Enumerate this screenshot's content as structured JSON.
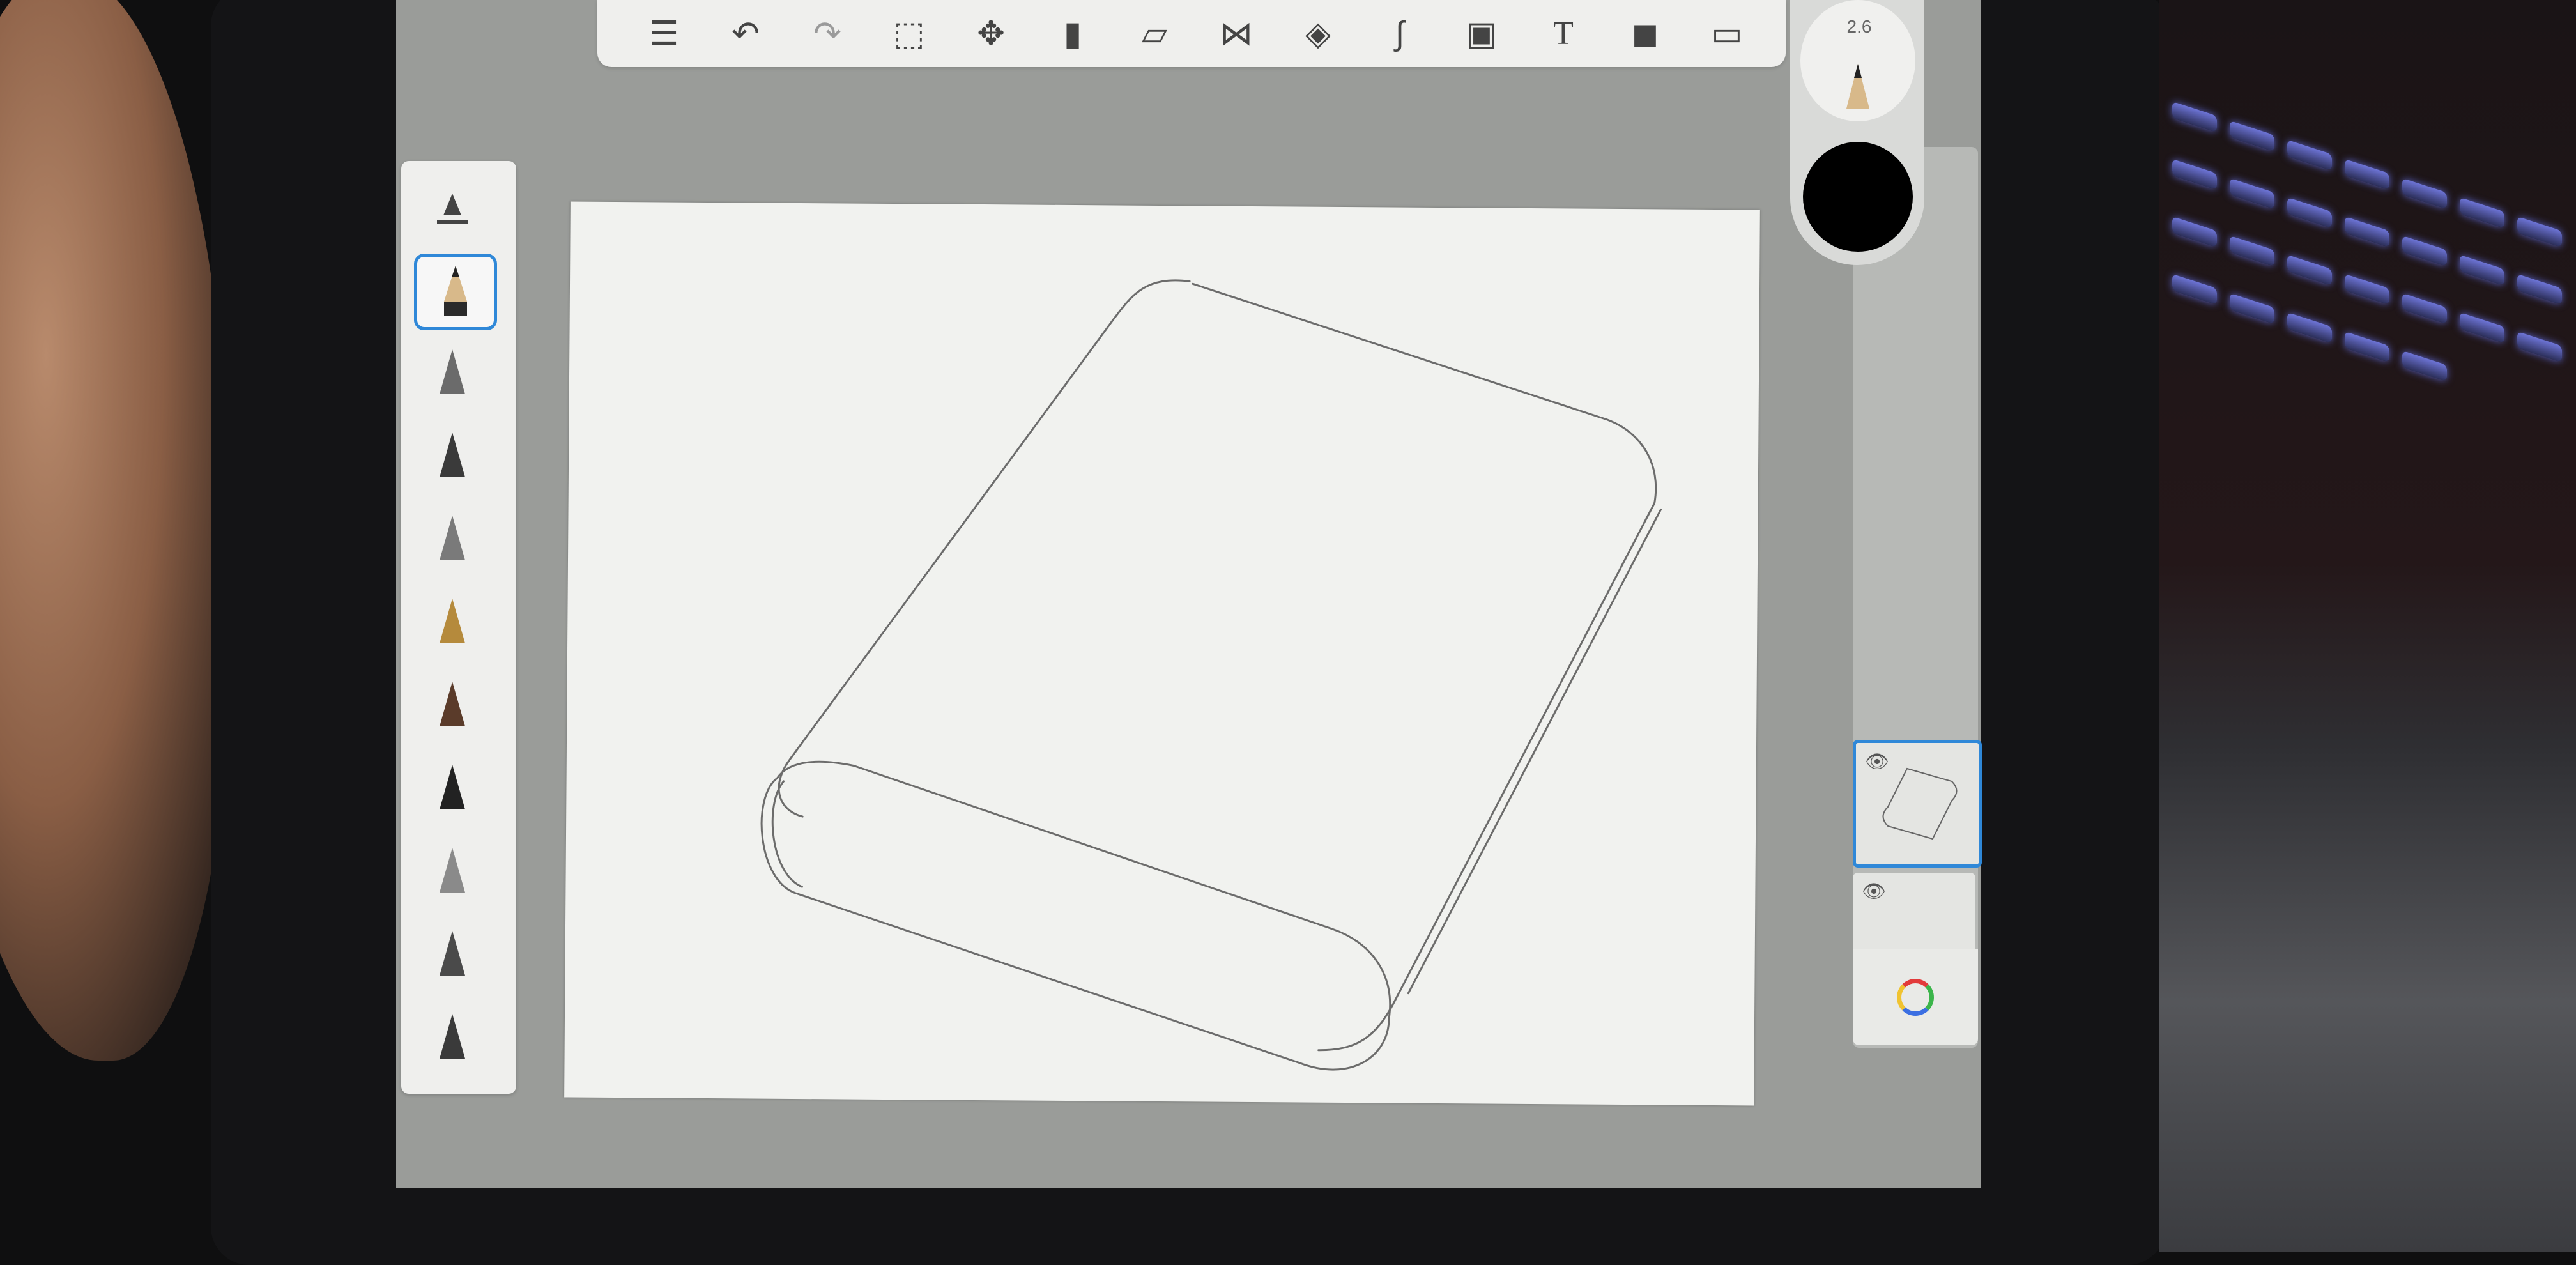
{
  "toolbar": {
    "items": [
      {
        "name": "layers-list-icon",
        "glyph": "☰"
      },
      {
        "name": "undo-icon",
        "glyph": "↶"
      },
      {
        "name": "redo-icon",
        "glyph": "↷"
      },
      {
        "name": "selection-icon",
        "glyph": "⬚"
      },
      {
        "name": "transform-icon",
        "glyph": "✥"
      },
      {
        "name": "fill-icon",
        "glyph": "▮"
      },
      {
        "name": "ruler-icon",
        "glyph": "▱"
      },
      {
        "name": "symmetry-icon",
        "glyph": "⋈"
      },
      {
        "name": "shapes-icon",
        "glyph": "◈"
      },
      {
        "name": "curve-icon",
        "glyph": "∫"
      },
      {
        "name": "image-icon",
        "glyph": "▣"
      },
      {
        "name": "text-icon",
        "glyph": "T"
      },
      {
        "name": "record-icon",
        "glyph": "◼"
      },
      {
        "name": "fullscreen-icon",
        "glyph": "▭"
      }
    ]
  },
  "brush_size": "2.6",
  "brushes": [
    {
      "name": "brush-settings-icon"
    },
    {
      "name": "pencil-brush-icon",
      "selected": true
    },
    {
      "name": "marker-brush-icon"
    },
    {
      "name": "ink-pen-brush-icon"
    },
    {
      "name": "felt-tip-brush-icon"
    },
    {
      "name": "fountain-pen-brush-icon"
    },
    {
      "name": "paint-brush-icon"
    },
    {
      "name": "chisel-brush-icon"
    },
    {
      "name": "airbrush-icon"
    },
    {
      "name": "eraser-brush-icon"
    },
    {
      "name": "smudge-brush-icon"
    }
  ],
  "colors": {
    "accent": "#2f88d8",
    "current_color": "#000000",
    "canvas": "#f1f2ef"
  }
}
